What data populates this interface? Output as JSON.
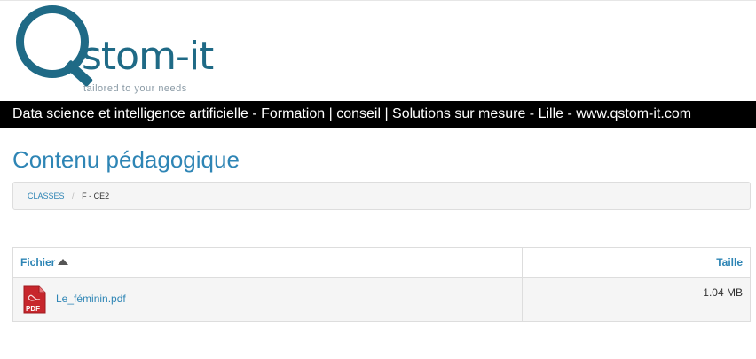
{
  "header": {
    "brand": "stom-it",
    "tagline": "tailored to your needs",
    "banner": "Data science et intelligence artificielle - Formation | conseil | Solutions sur mesure - Lille - www.qstom-it.com"
  },
  "page": {
    "title": "Contenu pédagogique"
  },
  "breadcrumb": {
    "items": [
      {
        "label": "CLASSES"
      },
      {
        "label": "F - CE2"
      }
    ],
    "separator": "/"
  },
  "files_table": {
    "columns": {
      "file": "Fichier",
      "size": "Taille"
    },
    "sort": {
      "column": "file",
      "direction": "ascending",
      "icon": "sort-up-icon"
    },
    "rows": [
      {
        "icon": "pdf-icon",
        "icon_label": "PDF",
        "name": "Le_féminin.pdf",
        "size": "1.04 MB"
      }
    ]
  },
  "colors": {
    "accent": "#2e85b5",
    "logo": "#1f6a86",
    "banner_bg": "#000000",
    "pdf_red": "#c7262c"
  }
}
